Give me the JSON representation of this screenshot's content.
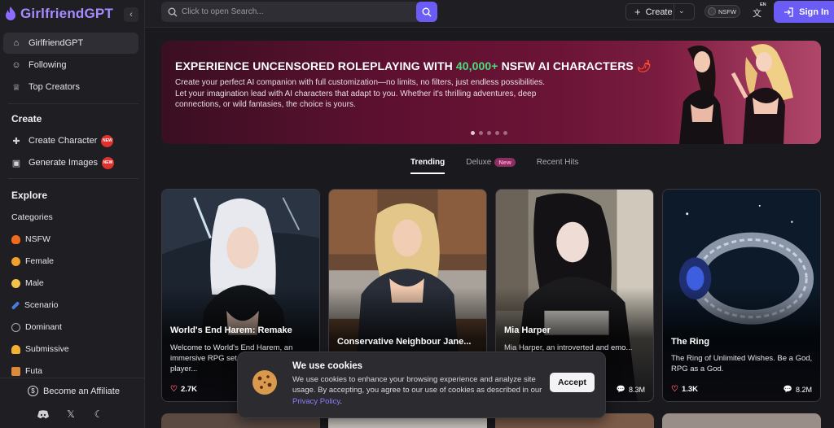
{
  "app": {
    "logo_text": "GirlfriendGPT"
  },
  "sidebar": {
    "nav": [
      {
        "label": "GirlfriendGPT",
        "icon": "home-icon"
      },
      {
        "label": "Following",
        "icon": "user-follow-icon"
      },
      {
        "label": "Top Creators",
        "icon": "trophy-icon"
      }
    ],
    "create_title": "Create",
    "create_items": [
      {
        "label": "Create Character",
        "badge": "NEW"
      },
      {
        "label": "Generate Images",
        "badge": "NEW"
      }
    ],
    "explore_title": "Explore",
    "categories_label": "Categories",
    "categories": [
      {
        "label": "NSFW",
        "color": "#f26b1d"
      },
      {
        "label": "Female",
        "color": "#f0a02c"
      },
      {
        "label": "Male",
        "color": "#f4c34a"
      },
      {
        "label": "Scenario",
        "color": "#4a7bd8"
      },
      {
        "label": "Dominant",
        "color": "#aaaaaa"
      },
      {
        "label": "Submissive",
        "color": "#f2b233"
      },
      {
        "label": "Futa",
        "color": "#d98a3a"
      }
    ],
    "affiliate_label": "Become an Affiliate"
  },
  "topbar": {
    "search_placeholder": "Click to open Search...",
    "create_label": "Create",
    "nsfw_label": "NSFW",
    "lang_badge": "EN",
    "signin_label": "Sign In"
  },
  "banner": {
    "title_pre": "EXPERIENCE UNCENSORED ROLEPLAYING WITH ",
    "title_highlight": "40,000+",
    "title_post": " NSFW AI CHARACTERS",
    "desc_line1": "Create your perfect AI companion with full customization—no limits, no filters, just endless possibilities.",
    "desc_line2": "Let your imagination lead with AI characters that adapt to you. Whether it's thrilling adventures, deep connections, or wild fantasies, the choice is yours.",
    "slides": 5,
    "active_slide": 0
  },
  "tabs": [
    {
      "label": "Trending",
      "active": true
    },
    {
      "label": "Deluxe",
      "badge": "New"
    },
    {
      "label": "Recent Hits"
    }
  ],
  "cards": [
    {
      "title": "World's End Harem: Remake",
      "desc": "Welcome to World's End Harem, an immersive RPG set... As you, the player...",
      "likes": "2.7K",
      "chats": ""
    },
    {
      "title": "Conservative Neighbour Jane...",
      "desc": "",
      "likes": "",
      "chats": ""
    },
    {
      "title": "Mia Harper",
      "desc": "Mia Harper, an introverted and emo... solitude, ...fashion...",
      "likes": "",
      "chats": "8.3M"
    },
    {
      "title": "The Ring",
      "desc": "The Ring of Unlimited Wishes. Be a God, RPG as a God.",
      "likes": "1.3K",
      "chats": "8.2M"
    }
  ],
  "cookie": {
    "title": "We use cookies",
    "text": "We use cookies to enhance your browsing experience and analyze site usage. By accepting, you agree to our use of cookies as described in our ",
    "link": "Privacy Policy",
    "text_end": ".",
    "accept_label": "Accept"
  },
  "colors": {
    "accent": "#6b5cf6",
    "banner_highlight": "#4ade80"
  }
}
